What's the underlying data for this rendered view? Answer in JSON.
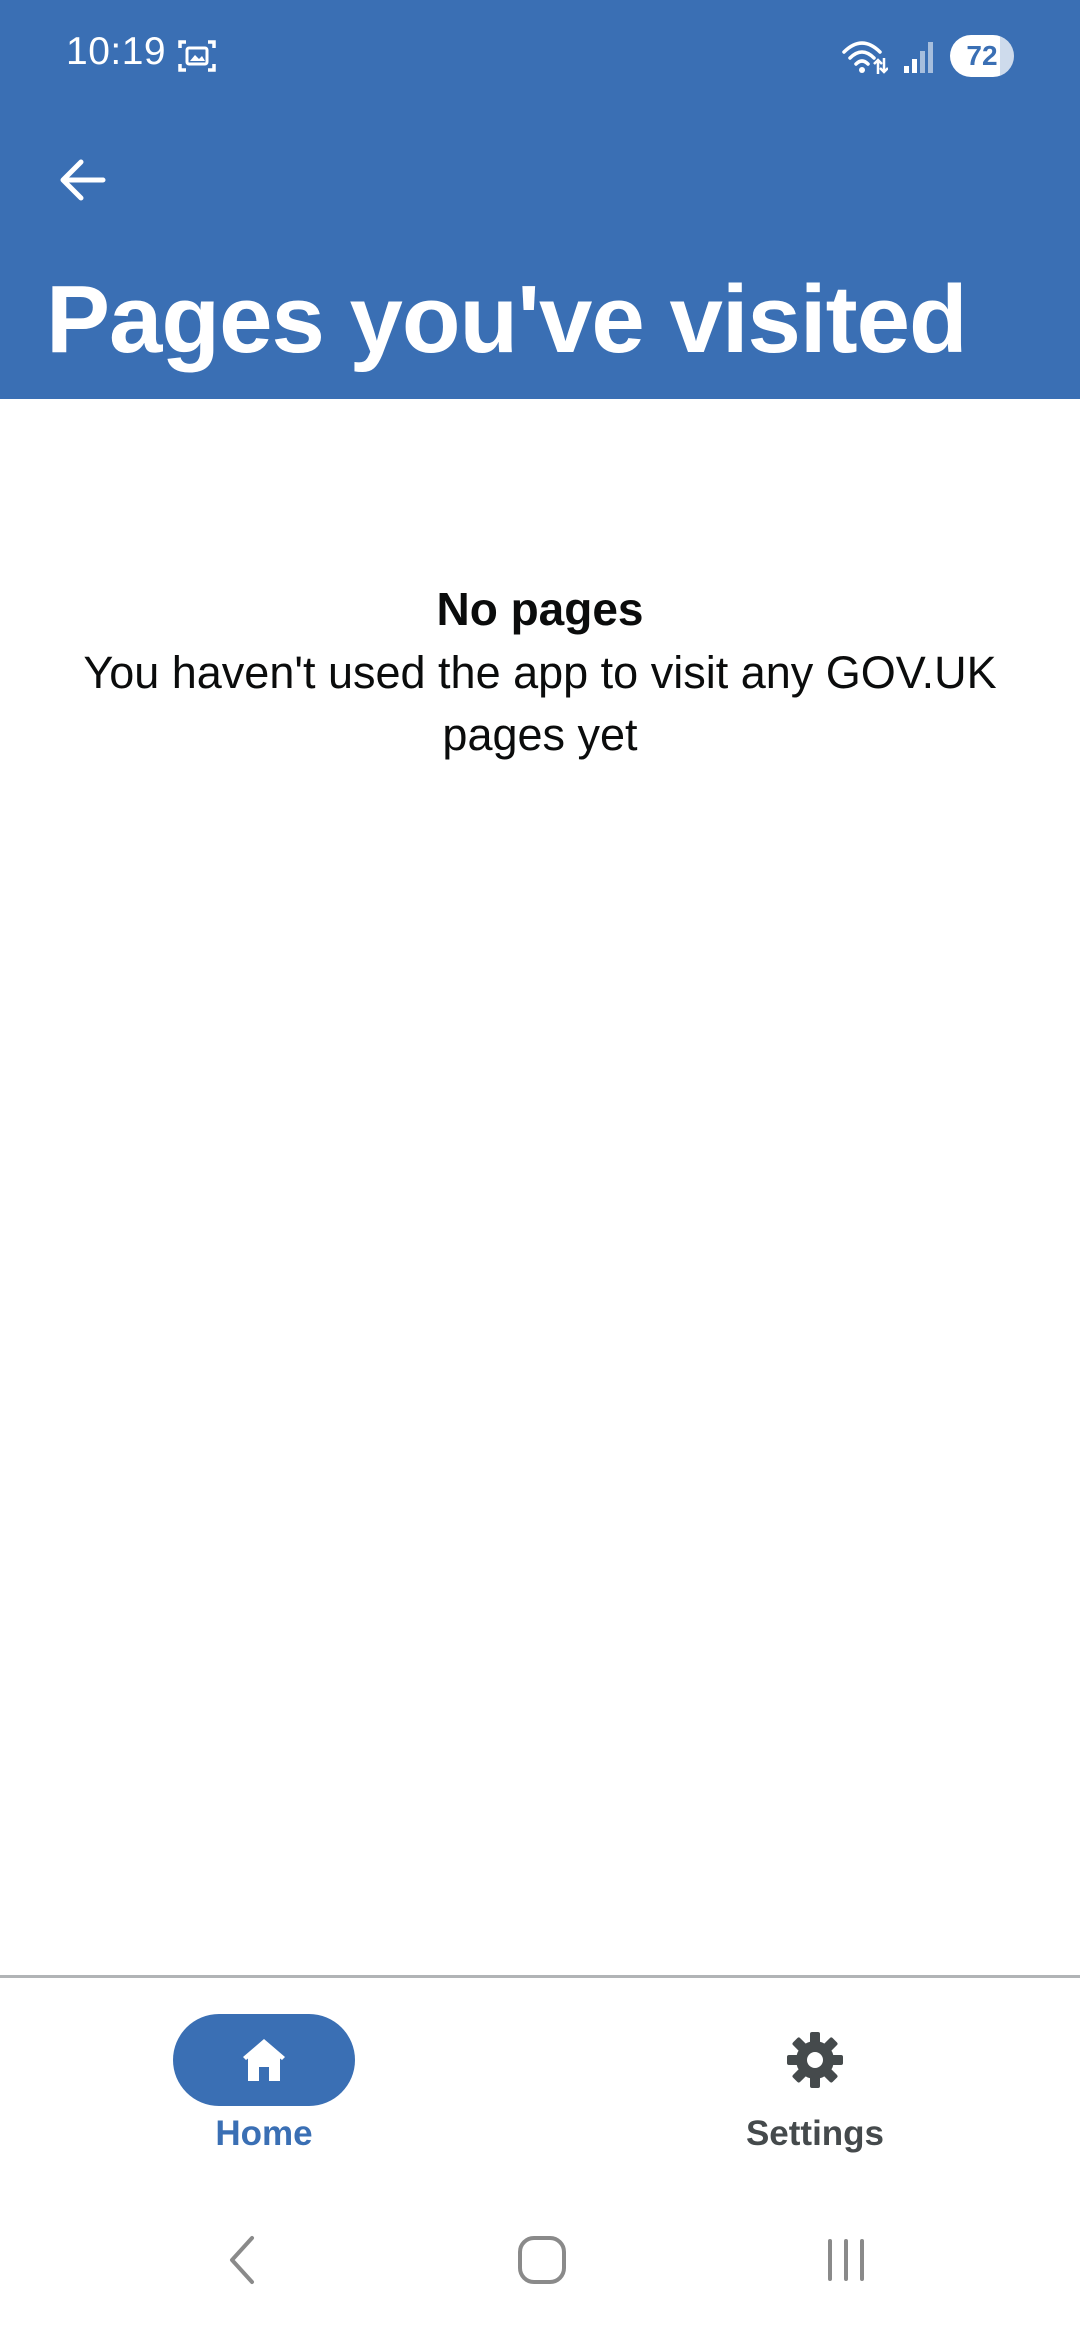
{
  "status_bar": {
    "time": "10:19",
    "battery_level": "72",
    "icons": [
      "screenshot-icon",
      "wifi-icon",
      "signal-icon",
      "battery-icon"
    ]
  },
  "app_bar": {
    "back_icon": "arrow-left-icon",
    "title": "Pages you've visited"
  },
  "empty_state": {
    "title": "No pages",
    "message": "You haven't used the app to visit any GOV.UK pages yet"
  },
  "bottom_nav": {
    "items": [
      {
        "label": "Home",
        "icon": "home-icon",
        "selected": true
      },
      {
        "label": "Settings",
        "icon": "gear-icon",
        "selected": false
      }
    ]
  },
  "system_nav": {
    "icons": [
      "back-icon",
      "home-icon",
      "recents-icon"
    ]
  },
  "colors": {
    "brand_blue": "#3a6fb4",
    "text_primary": "#0b0c0c",
    "text_secondary": "#454a4c",
    "divider": "#b1b4b6"
  }
}
